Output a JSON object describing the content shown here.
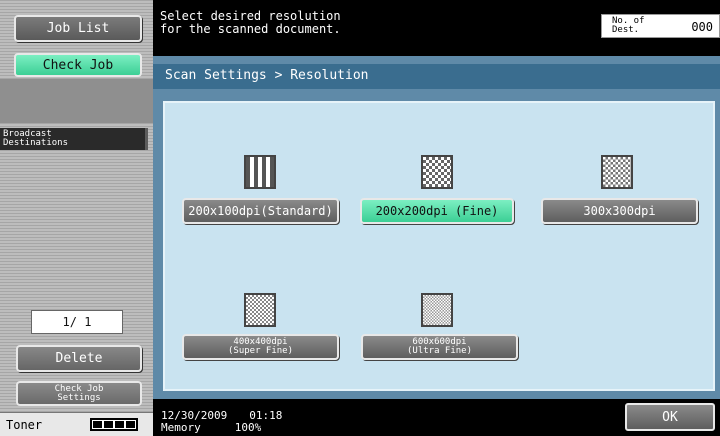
{
  "left": {
    "job_list": "Job List",
    "check_job": "Check Job",
    "broadcast_line1": "Broadcast",
    "broadcast_line2": "Destinations",
    "page_counter": "1/ 1",
    "delete": "Delete",
    "check_job_settings_line1": "Check Job",
    "check_job_settings_line2": "Settings",
    "toner": "Toner"
  },
  "message": {
    "line1": "Select desired resolution",
    "line2": "for the scanned document."
  },
  "dest": {
    "label_line1": "No. of",
    "label_line2": "Dest.",
    "value": "000"
  },
  "header": "Scan Settings > Resolution",
  "resolutions": [
    {
      "label": "200x100dpi(Standard)",
      "selected": false,
      "icon": "coarse-pattern-icon"
    },
    {
      "label": "200x200dpi (Fine)",
      "selected": true,
      "icon": "fine-pattern-icon"
    },
    {
      "label": "300x300dpi",
      "selected": false,
      "icon": "300dpi-pattern-icon"
    },
    {
      "line1": "400x400dpi",
      "line2": "(Super Fine)",
      "selected": false,
      "icon": "super-fine-pattern-icon"
    },
    {
      "line1": "600x600dpi",
      "line2": "(Ultra Fine)",
      "selected": false,
      "icon": "ultra-fine-pattern-icon"
    }
  ],
  "status": {
    "date": "12/30/2009",
    "time": "01:18",
    "memory_label": "Memory",
    "memory_value": "100%"
  },
  "ok": "OK",
  "colors": {
    "selected": "#3ccf95",
    "panel": "#5f8aa8",
    "content": "#c9e3f0"
  }
}
